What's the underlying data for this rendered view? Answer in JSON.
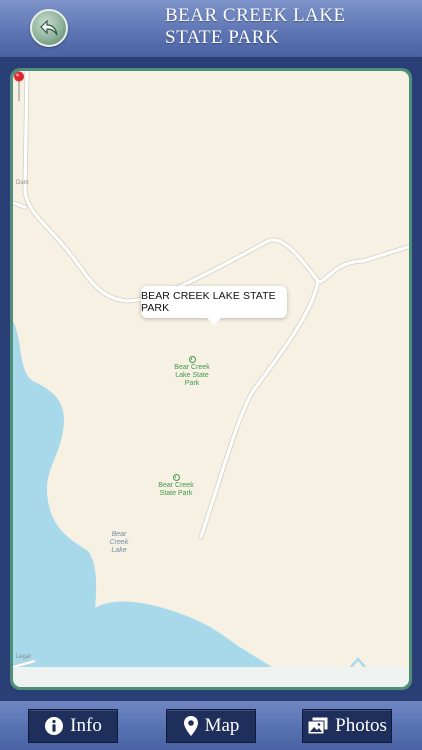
{
  "header": {
    "title": "BEAR CREEK LAKE STATE PARK",
    "back_icon": "back-arrow-icon"
  },
  "map": {
    "callout_text": "BEAR CREEK LAKE STATE PARK",
    "poi_1": "Bear Creek Lake State Park",
    "poi_2": "Bear Creek State Park",
    "lake_label": "Bear Creek Lake",
    "label_dam": "Dam",
    "label_legal": "Legal",
    "colors": {
      "land": "#f7f1e4",
      "water": "#a8d9ea",
      "road": "#ffffff",
      "poi": "#3f9a4a",
      "pin": "#e0262e"
    }
  },
  "bottom_bar": {
    "info_label": "Info",
    "map_label": "Map",
    "photos_label": "Photos"
  }
}
